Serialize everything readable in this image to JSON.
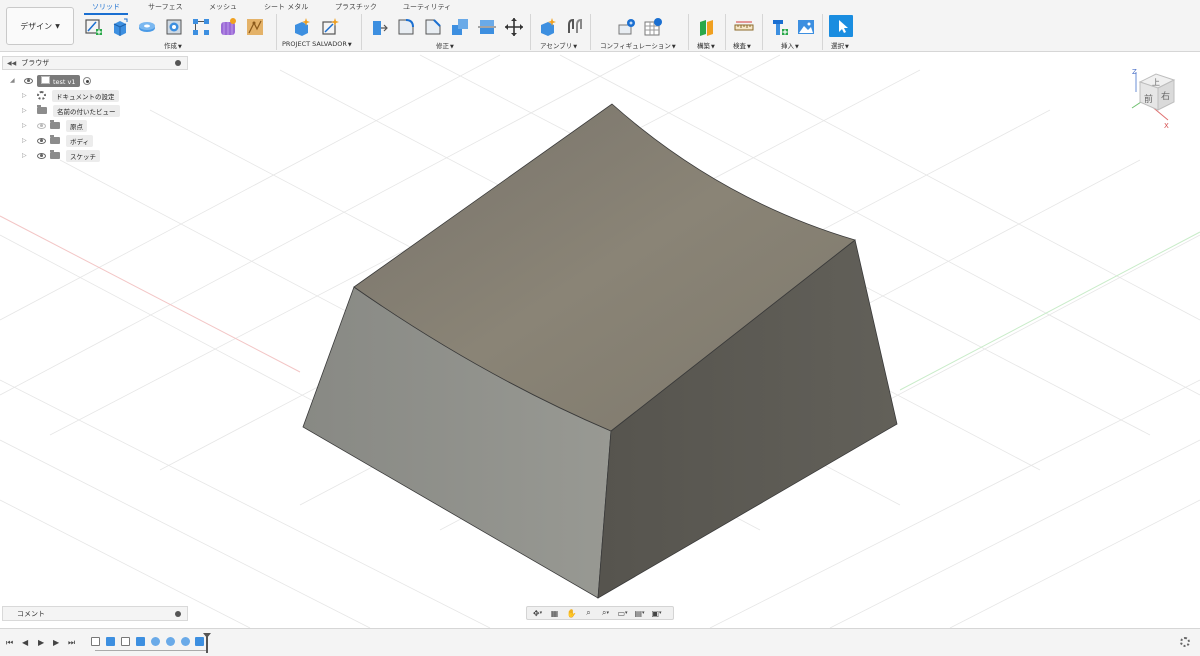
{
  "toolbar": {
    "workspace_label": "デザイン",
    "tabs": [
      {
        "label": "ソリッド",
        "active": true
      },
      {
        "label": "サーフェス",
        "active": false
      },
      {
        "label": "メッシュ",
        "active": false
      },
      {
        "label": "シート メタル",
        "active": false
      },
      {
        "label": "プラスチック",
        "active": false
      },
      {
        "label": "ユーティリティ",
        "active": false
      }
    ],
    "groups": {
      "create": "作成",
      "project_salvador": "PROJECT SALVADOR",
      "modify": "修正",
      "assemble": "アセンブリ",
      "configuration": "コンフィギュレーション",
      "construct": "構築",
      "inspect": "検査",
      "insert": "挿入",
      "select": "選択"
    }
  },
  "browser": {
    "title": "ブラウザ",
    "root_label": "test v1",
    "items": [
      {
        "label": "ドキュメントの設定",
        "icon": "gear-icon",
        "visible": null
      },
      {
        "label": "名前の付いたビュー",
        "icon": "folder-icon",
        "visible": null
      },
      {
        "label": "原点",
        "icon": "folder-icon",
        "visible": false
      },
      {
        "label": "ボディ",
        "icon": "folder-icon",
        "visible": true
      },
      {
        "label": "スケッチ",
        "icon": "folder-icon",
        "visible": true
      }
    ]
  },
  "comments": {
    "title": "コメント"
  },
  "viewcube": {
    "top": "上",
    "front": "前",
    "right": "右",
    "axis_z": "Z",
    "axis_x": "X"
  },
  "colors": {
    "accent": "#1a6fd1",
    "body_top": "#858073",
    "body_left": "#8e8f8a",
    "body_right": "#5c5a54"
  }
}
